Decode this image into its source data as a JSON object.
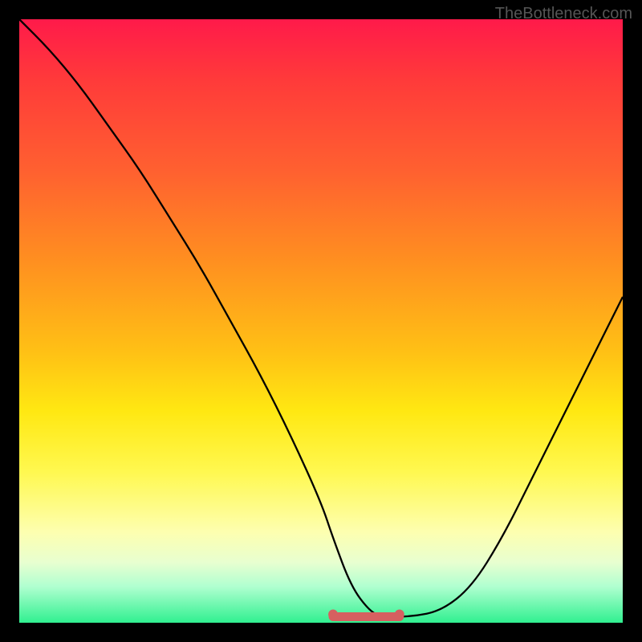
{
  "watermark": "TheBottleneck.com",
  "chart_data": {
    "type": "line",
    "title": "",
    "xlabel": "",
    "ylabel": "",
    "xlim": [
      0,
      100
    ],
    "ylim": [
      0,
      100
    ],
    "series": [
      {
        "name": "curve",
        "x": [
          0,
          5,
          10,
          15,
          20,
          25,
          30,
          35,
          40,
          45,
          50,
          52,
          55,
          58,
          60,
          65,
          70,
          75,
          80,
          85,
          90,
          95,
          100
        ],
        "values": [
          100,
          95,
          89,
          82,
          75,
          67,
          59,
          50,
          41,
          31,
          20,
          14,
          6,
          2,
          1,
          1,
          2,
          6,
          14,
          24,
          34,
          44,
          54
        ]
      }
    ],
    "flat_marker": {
      "x_start": 52,
      "x_end": 63,
      "y": 1,
      "color": "#d66060"
    },
    "gradient_stops": [
      {
        "pos": 0,
        "color": "#ff1a4a"
      },
      {
        "pos": 25,
        "color": "#ff6030"
      },
      {
        "pos": 55,
        "color": "#ffc015"
      },
      {
        "pos": 85,
        "color": "#fdffb0"
      },
      {
        "pos": 100,
        "color": "#30f090"
      }
    ]
  }
}
